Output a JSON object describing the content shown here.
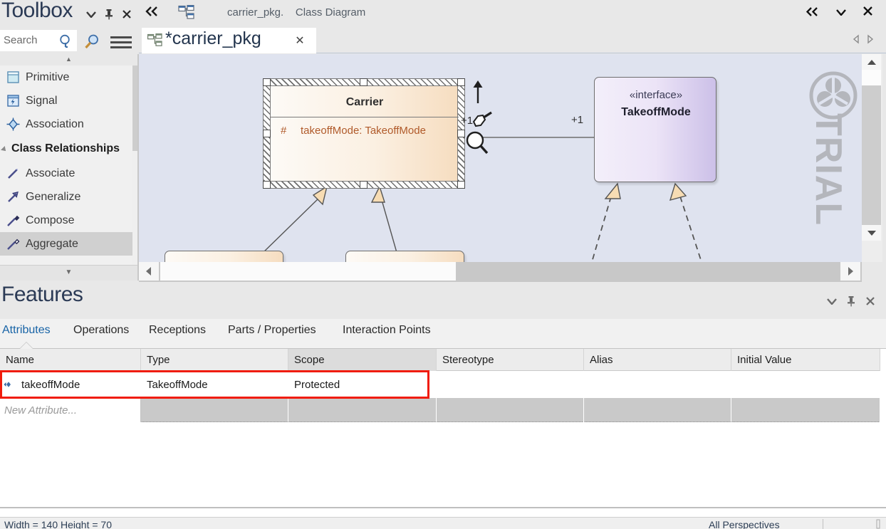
{
  "toolbox": {
    "title": "Toolbox",
    "dropdown_icon": "chevron-down-icon",
    "pin_icon": "pin-icon",
    "close_icon": "close-icon",
    "search": {
      "placeholder": "Search",
      "value": "Search",
      "magnifier_icon": "search-icon",
      "go_icon": "search-go-icon",
      "menu_icon": "hamburger-menu-icon"
    },
    "scroll_up_glyph": "▲",
    "scroll_down_glyph": "▼",
    "items": [
      {
        "label": "Primitive",
        "icon": "primitive-icon",
        "type": "item",
        "selected": false
      },
      {
        "label": "Signal",
        "icon": "signal-icon",
        "type": "item",
        "selected": false
      },
      {
        "label": "Association",
        "icon": "association-icon",
        "type": "item",
        "selected": false
      },
      {
        "label": "Class Relationships",
        "icon": "expander-icon",
        "type": "group",
        "selected": false
      },
      {
        "label": "Associate",
        "icon": "associate-icon",
        "type": "item",
        "selected": false
      },
      {
        "label": "Generalize",
        "icon": "generalize-icon",
        "type": "item",
        "selected": false
      },
      {
        "label": "Compose",
        "icon": "compose-icon",
        "type": "item",
        "selected": false
      },
      {
        "label": "Aggregate",
        "icon": "aggregate-icon",
        "type": "item",
        "selected": true
      }
    ]
  },
  "diagram_panel": {
    "collapse_icon": "double-chevron-left-icon",
    "breadcrumb_icon": "class-diagram-icon",
    "breadcrumb": "carrier_pkg.",
    "breadcrumb_tail": "Class Diagram",
    "top_right": {
      "collapse_label": "«",
      "dropdown_label": "▼",
      "close_label": "✕"
    },
    "tab": {
      "label": "*carrier_pkg",
      "icon": "class-diagram-icon",
      "close_label": "✕"
    },
    "tab_nav": {
      "prev_icon": "triangle-left-icon",
      "next_icon": "triangle-right-icon"
    },
    "watermark": {
      "text": "TRIAL",
      "logo_icon": "sparx-logo-icon"
    }
  },
  "canvas": {
    "carrier": {
      "name": "Carrier",
      "attribute_visibility": "#",
      "attribute_text": "takeoffMode: TakeoffMode",
      "selected": true
    },
    "interface": {
      "stereotype": "«interface»",
      "name": "TakeoffMode"
    },
    "association_multiplicity": "+1",
    "quicklinks": {
      "up_arrow_icon": "quicklink-arrow-icon",
      "pointer_icon": "quicklink-pointer-icon",
      "plus_label": "+1",
      "magnifier_icon": "zoom-icon"
    },
    "scroll": {
      "h_left_icon": "triangle-left-icon",
      "h_right_icon": "triangle-right-icon",
      "v_up_icon": "triangle-up-icon",
      "v_down_icon": "triangle-down-icon"
    }
  },
  "features": {
    "title": "Features",
    "dropdown_icon": "chevron-down-icon",
    "pin_icon": "pin-icon",
    "close_icon": "close-icon",
    "tabs": [
      {
        "label": "Attributes",
        "active": true
      },
      {
        "label": "Operations",
        "active": false
      },
      {
        "label": "Receptions",
        "active": false
      },
      {
        "label": "Parts / Properties",
        "active": false
      },
      {
        "label": "Interaction Points",
        "active": false
      }
    ],
    "columns": [
      "Name",
      "Type",
      "Scope",
      "Stereotype",
      "Alias",
      "Initial Value"
    ],
    "highlighted_column": "Scope",
    "rows": [
      {
        "icon": "attribute-icon",
        "name": "takeoffMode",
        "type": "TakeoffMode",
        "scope": "Protected",
        "stereotype": "",
        "alias": "",
        "initial_value": "",
        "highlighted": true
      }
    ],
    "new_row_placeholder": "New Attribute...",
    "highlight_color": "#f01c0c"
  },
  "statusbar": {
    "left": "Width = 140  Height = 70",
    "right": "All Perspectives"
  }
}
